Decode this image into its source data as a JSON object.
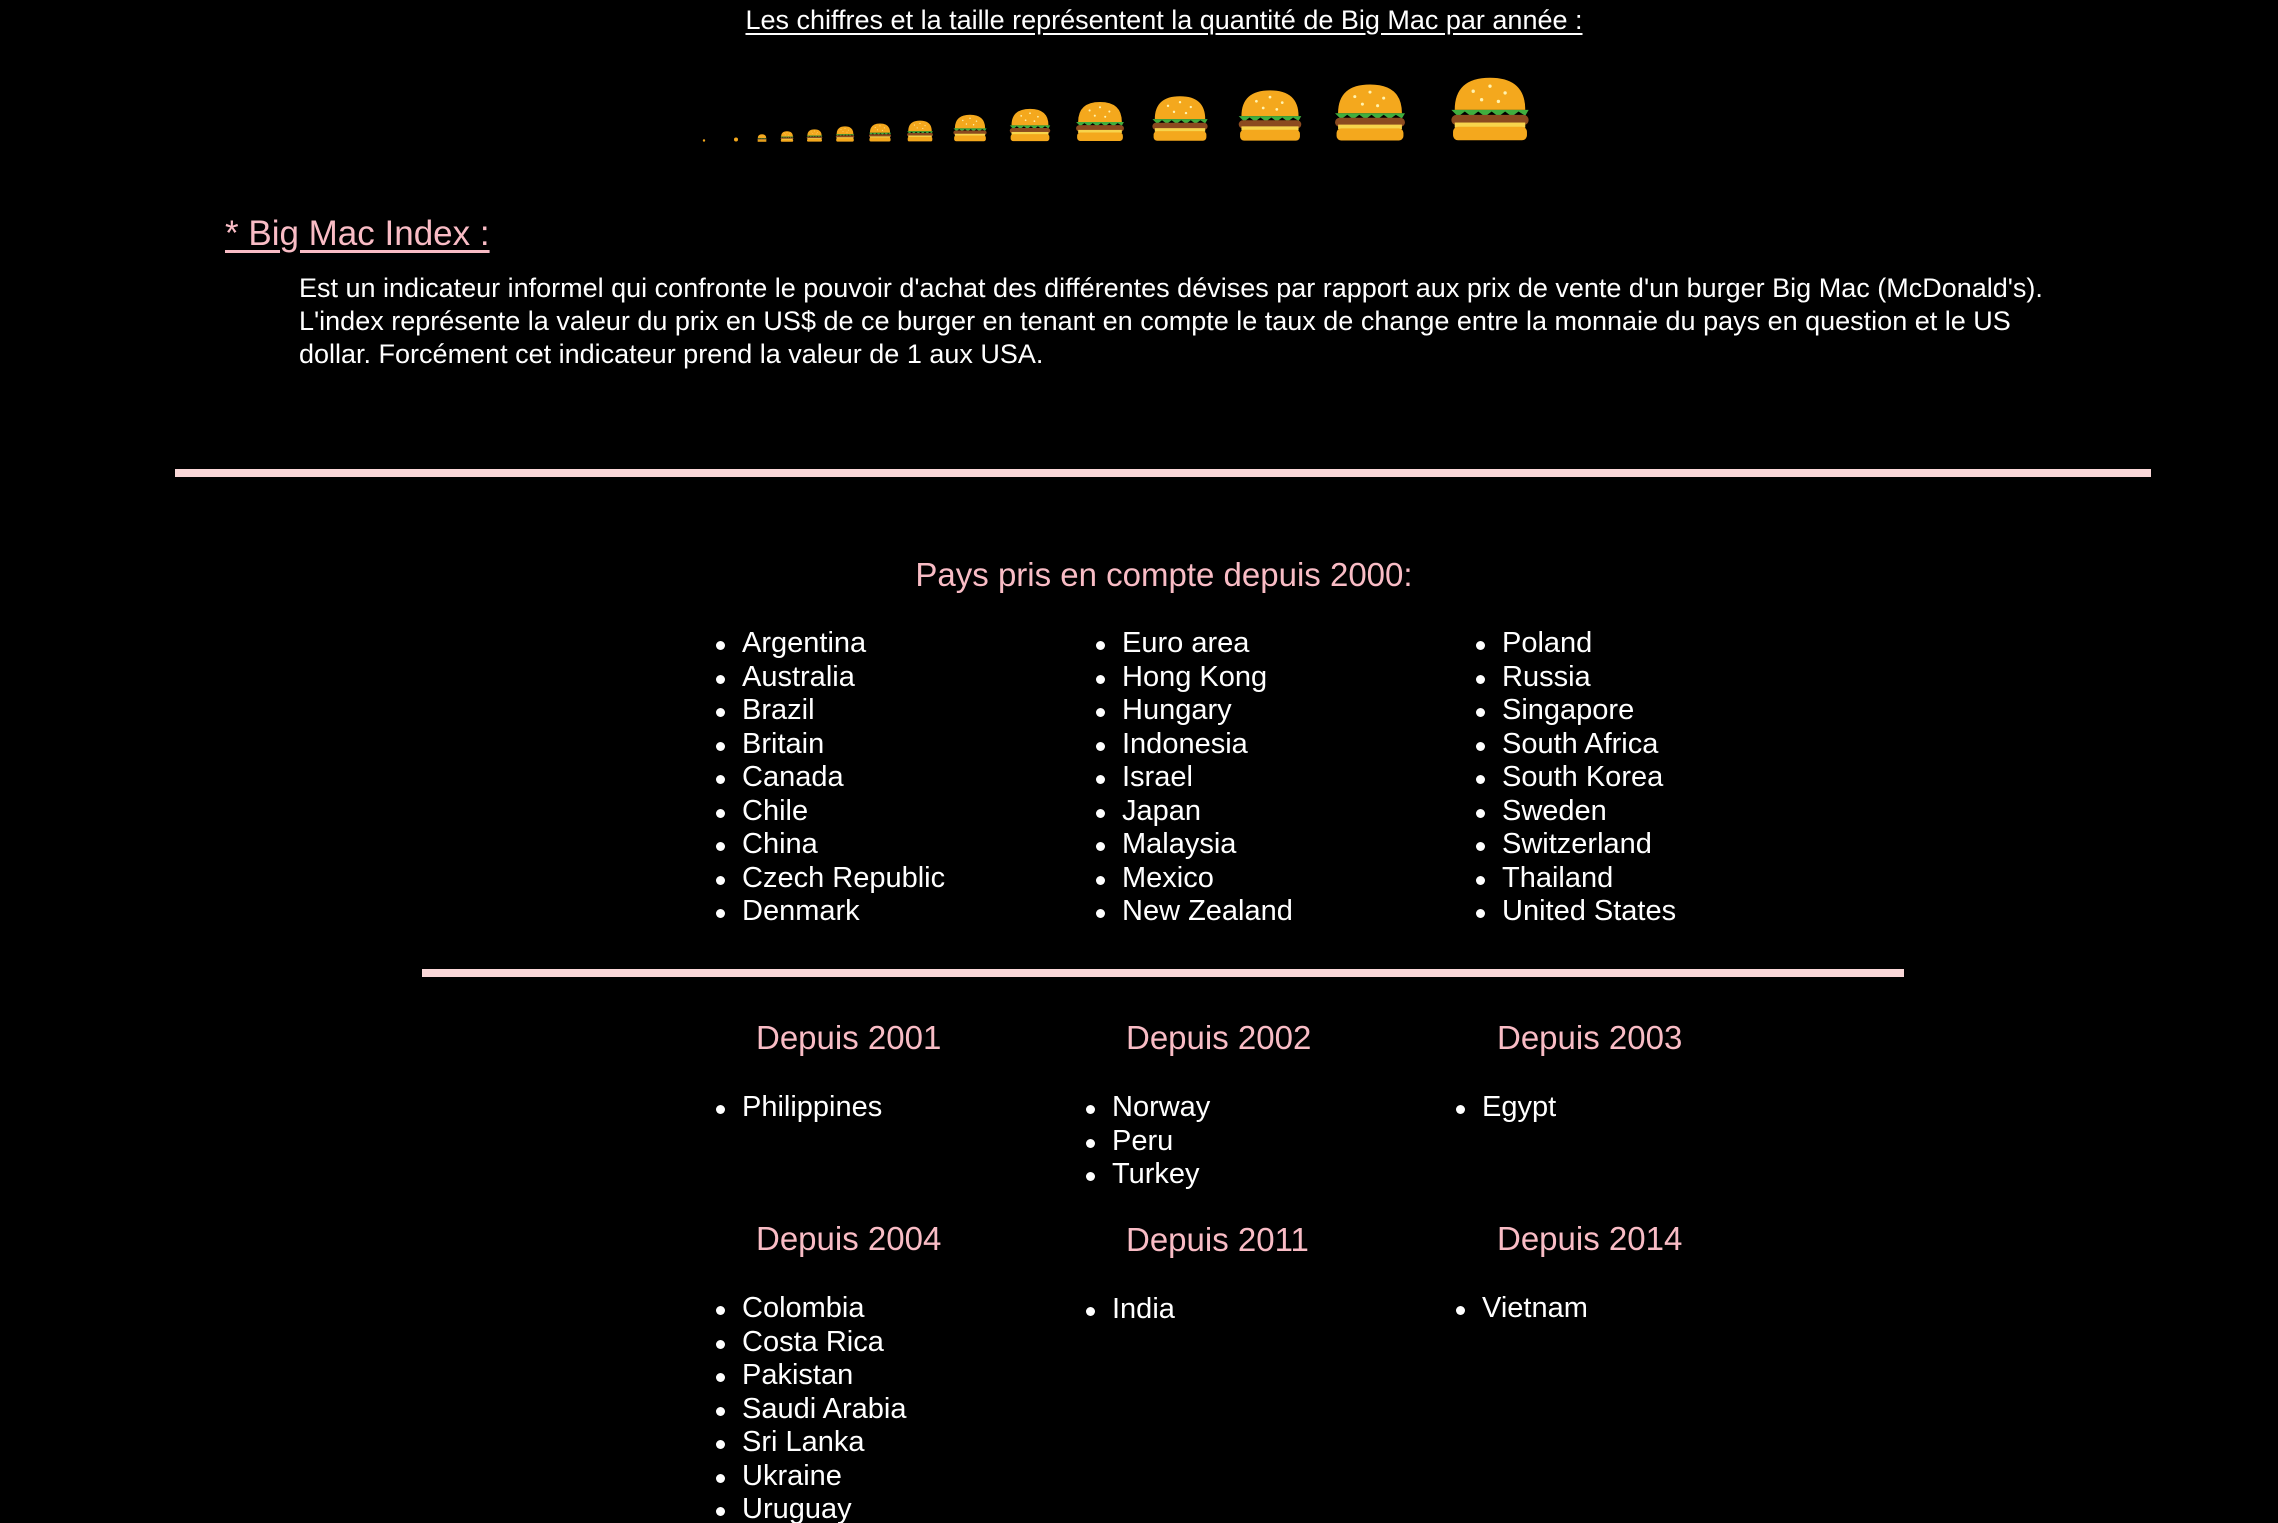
{
  "legend": {
    "title": "Les chiffres et la taille représentent la quantité de Big Mac par année :",
    "icon": "burger-icon",
    "burger_count": 15
  },
  "index": {
    "heading": "* Big Mac Index :",
    "text": "Est un indicateur informel qui confronte le pouvoir d'achat des différentes dévises par rapport aux prix de vente d'un burger Big Mac (McDonald's). L'index représente la valeur du prix en US$ de ce burger en tenant en compte le taux de change entre la monnaie du pays en question et le US dollar. Forcément cet indicateur prend la valeur de 1 aux USA."
  },
  "countries_2000": {
    "title": "Pays pris en compte depuis 2000:",
    "col1": [
      "Argentina",
      "Australia",
      "Brazil",
      "Britain",
      "Canada",
      "Chile",
      "China",
      "Czech Republic",
      "Denmark"
    ],
    "col2": [
      "Euro area",
      "Hong Kong",
      "Hungary",
      "Indonesia",
      "Israel",
      "Japan",
      "Malaysia",
      "Mexico",
      "New Zealand"
    ],
    "col3": [
      "Poland",
      "Russia",
      "Singapore",
      "South Africa",
      "South Korea",
      "Sweden",
      "Switzerland",
      "Thailand",
      "United States"
    ]
  },
  "later_years": [
    {
      "heading": "Depuis 2001",
      "countries": [
        "Philippines"
      ]
    },
    {
      "heading": "Depuis 2002",
      "countries": [
        "Norway",
        "Peru",
        "Turkey"
      ]
    },
    {
      "heading": "Depuis 2003",
      "countries": [
        "Egypt"
      ]
    },
    {
      "heading": "Depuis 2004",
      "countries": [
        "Colombia",
        "Costa Rica",
        "Pakistan",
        "Saudi Arabia",
        "Sri Lanka",
        "Ukraine",
        "Uruguay"
      ]
    },
    {
      "heading": "Depuis 2011",
      "countries": [
        "India"
      ]
    },
    {
      "heading": "Depuis 2014",
      "countries": [
        "Vietnam"
      ]
    }
  ],
  "colors": {
    "background": "#000000",
    "accent_pink": "#f9bcc5",
    "rule": "#fad7d8",
    "bun": "#f4a81d",
    "patty": "#8b4a1f",
    "lettuce": "#3fae3f"
  }
}
